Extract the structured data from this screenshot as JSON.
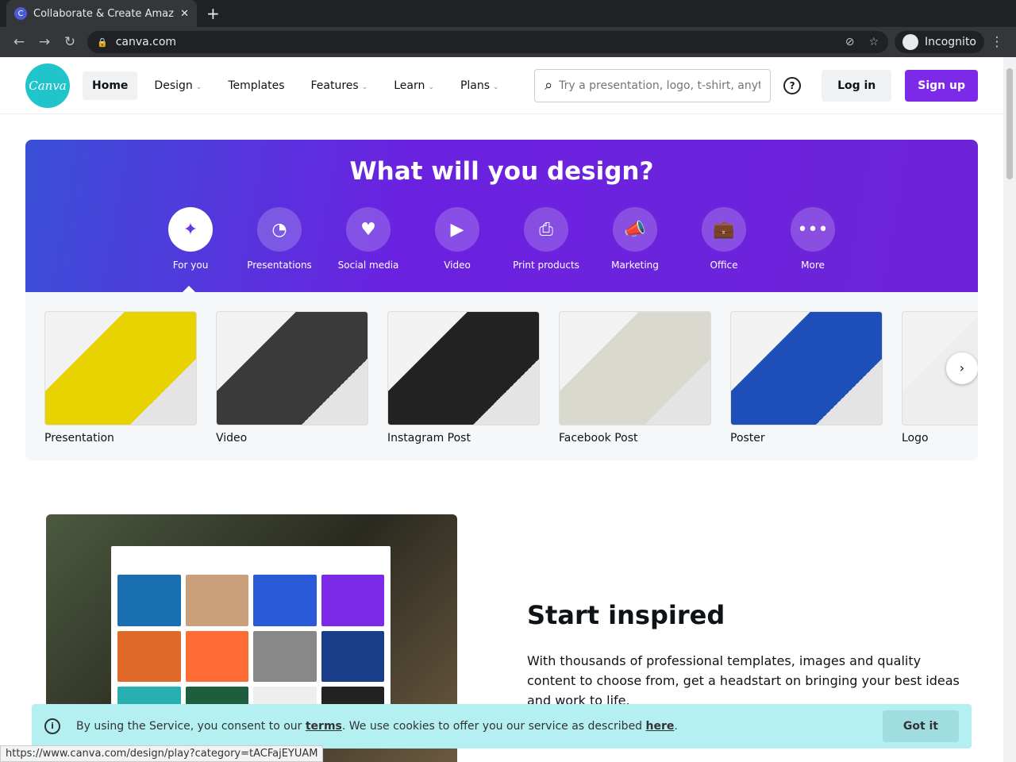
{
  "browser": {
    "tab_title": "Collaborate & Create Amaz",
    "favicon": "C",
    "url": "canva.com",
    "profile": "Incognito",
    "status_url": "https://www.canva.com/design/play?category=tACFajEYUAM"
  },
  "header": {
    "logo": "Canva",
    "nav": [
      {
        "label": "Home"
      },
      {
        "label": "Design"
      },
      {
        "label": "Templates"
      },
      {
        "label": "Features"
      },
      {
        "label": "Learn"
      },
      {
        "label": "Plans"
      }
    ],
    "search_placeholder": "Try a presentation, logo, t-shirt, anyt",
    "help": "?",
    "login": "Log in",
    "signup": "Sign up"
  },
  "hero": {
    "title": "What will you design?",
    "categories": [
      {
        "label": "For you",
        "icon": "✦"
      },
      {
        "label": "Presentations",
        "icon": "◔"
      },
      {
        "label": "Social media",
        "icon": "♥"
      },
      {
        "label": "Video",
        "icon": "▶"
      },
      {
        "label": "Print products",
        "icon": "⎙"
      },
      {
        "label": "Marketing",
        "icon": "📣"
      },
      {
        "label": "Office",
        "icon": "💼"
      },
      {
        "label": "More",
        "icon": "•••"
      }
    ]
  },
  "designs": [
    {
      "label": "Presentation",
      "color": "#e8d200"
    },
    {
      "label": "Video",
      "color": "#3a3a3a"
    },
    {
      "label": "Instagram Post",
      "color": "#222"
    },
    {
      "label": "Facebook Post",
      "color": "#d9d9d0"
    },
    {
      "label": "Poster",
      "color": "#1e4fb8"
    },
    {
      "label": "Logo",
      "color": "#eee"
    }
  ],
  "inspired": {
    "title": "Start inspired",
    "body": "With thousands of professional templates, images and quality content to choose from, get a headstart on bringing your best ideas and work to life."
  },
  "cookie": {
    "pre": "By using the Service, you consent to our ",
    "terms": "terms",
    "mid": ". We use cookies to offer you our service as described ",
    "here": "here",
    "post": ".",
    "button": "Got it"
  },
  "colors": {
    "brand": "#7d2ae8",
    "teal": "#20c4cb"
  }
}
